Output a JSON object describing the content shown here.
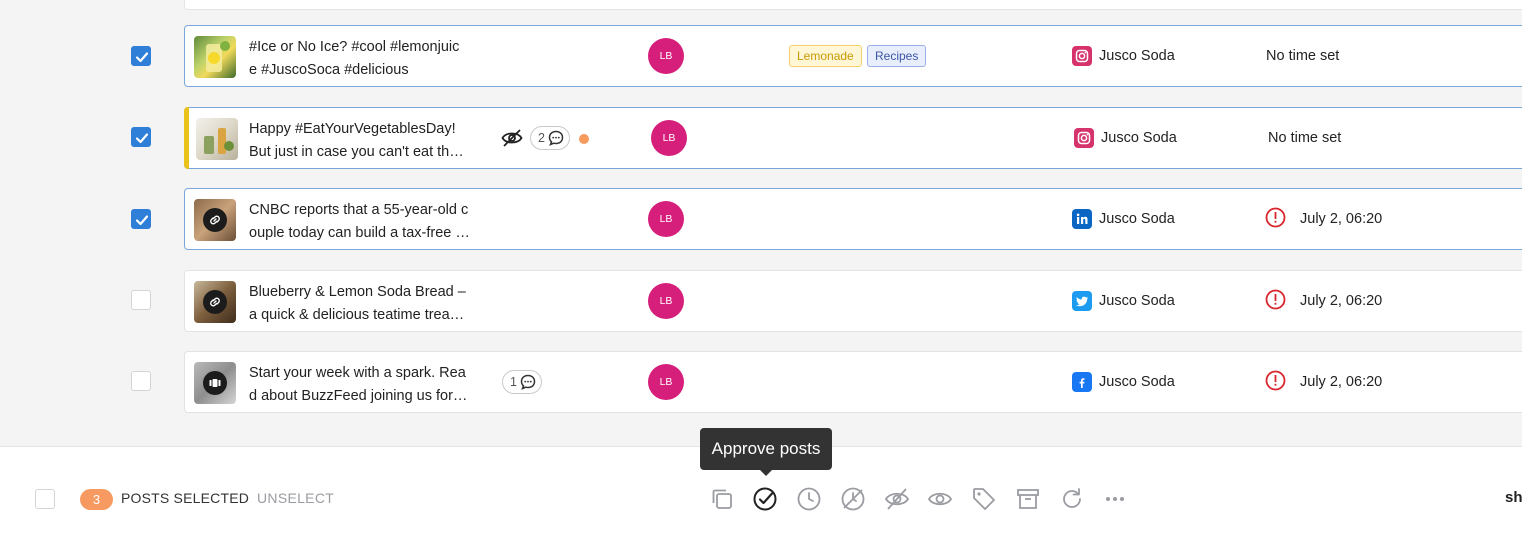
{
  "posts": [
    {
      "selected": true,
      "text_line1": "#Ice or No Ice? #cool #lemonjuic",
      "text_line2": "e #JuscoSoca #delicious",
      "avatar": "LB",
      "tags": [
        {
          "label": "Lemonade",
          "bg": "#fff6d6",
          "border": "#f1d36b",
          "color": "#c99a00"
        },
        {
          "label": "Recipes",
          "bg": "#e8eefc",
          "border": "#9ab0e6",
          "color": "#3b55a8"
        }
      ],
      "network": "instagram",
      "account": "Jusco Soda",
      "time": "No time set",
      "time_warning": false
    },
    {
      "selected": true,
      "text_line1": "Happy #EatYourVegetablesDay!",
      "text_line2": "But just in case you can't eat th…",
      "hidden_indicator": true,
      "comments": "2",
      "unread_dot": true,
      "avatar": "LB",
      "network": "instagram",
      "account": "Jusco Soda",
      "time": "No time set",
      "time_warning": false
    },
    {
      "selected": true,
      "text_line1": "CNBC reports that a 55-year-old c",
      "text_line2": "ouple today can build a tax-free …",
      "avatar": "LB",
      "network": "linkedin",
      "account": "Jusco Soda",
      "time": "July 2, 06:20",
      "time_warning": true
    },
    {
      "selected": false,
      "text_line1": "Blueberry & Lemon Soda Bread –",
      "text_line2": "a quick & delicious teatime trea…",
      "avatar": "LB",
      "network": "twitter",
      "account": "Jusco Soda",
      "time": "July 2, 06:20",
      "time_warning": true
    },
    {
      "selected": false,
      "text_line1": "Start your week with a spark. Rea",
      "text_line2": "d about BuzzFeed joining us for…",
      "comments": "1",
      "avatar": "LB",
      "network": "facebook",
      "account": "Jusco Soda",
      "time": "July 2, 06:20",
      "time_warning": true
    }
  ],
  "bottom_bar": {
    "selected_count": "3",
    "selected_label": "POSTS SELECTED",
    "unselect_label": "UNSELECT",
    "tooltip": "Approve posts",
    "right_cut_text": "sh",
    "tools": [
      "duplicate-icon",
      "approve-icon",
      "schedule-icon",
      "unschedule-icon",
      "hide-icon",
      "show-icon",
      "tag-icon",
      "archive-icon",
      "refresh-icon",
      "more-icon"
    ]
  },
  "colors": {
    "accent": "#2f7ed8",
    "avatar": "#d61e7b",
    "warning": "#d9262c",
    "badge": "#f79a62"
  }
}
